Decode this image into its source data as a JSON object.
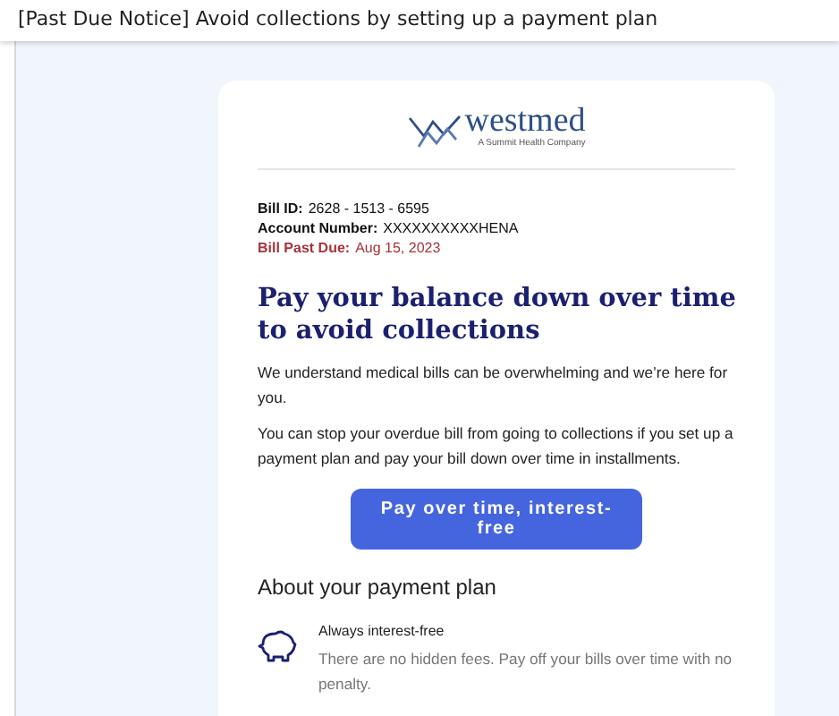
{
  "subject": "[Past Due Notice] Avoid collections by setting up a payment plan",
  "logo": {
    "name": "westmed",
    "tagline": "A Summit Health Company"
  },
  "bill_details": [
    {
      "label": "Bill ID:",
      "value": "2628 - 1513 - 6595",
      "kind": "normal"
    },
    {
      "label": "Account Number:",
      "value": "XXXXXXXXXXHENA",
      "kind": "normal"
    },
    {
      "label": "Bill Past Due:",
      "value": "Aug 15, 2023",
      "kind": "alert"
    }
  ],
  "headline": "Pay your balance down over time to avoid collections",
  "paragraphs": [
    "We understand medical bills can be overwhelming and we’re here for you.",
    "You can stop your overdue bill from going to collections if you set up a payment plan and pay your bill down over time in installments."
  ],
  "cta_button": "Pay over time, interest-free",
  "section_title": "About your payment plan",
  "features": [
    {
      "title": "Always interest-free",
      "description": "There are no hidden fees. Pay off your bills over time with no penalty."
    }
  ]
}
